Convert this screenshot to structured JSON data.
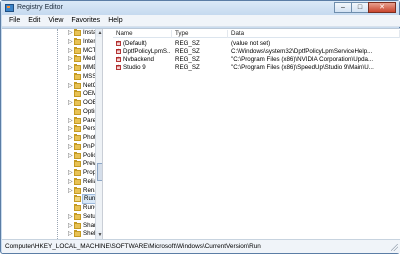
{
  "window": {
    "title": "Registry Editor",
    "controls": [
      "–",
      "□",
      "✕"
    ]
  },
  "menu": [
    "File",
    "Edit",
    "View",
    "Favorites",
    "Help"
  ],
  "tree": {
    "items": [
      {
        "label": "Installe",
        "expander": "▷"
      },
      {
        "label": "Interne",
        "expander": "▷"
      },
      {
        "label": "MCT",
        "expander": "▷"
      },
      {
        "label": "Media",
        "expander": "▷"
      },
      {
        "label": "MMDe",
        "expander": "▷"
      },
      {
        "label": "MSSHA",
        "expander": ""
      },
      {
        "label": "NetCac",
        "expander": "▷"
      },
      {
        "label": "OEMIn",
        "expander": ""
      },
      {
        "label": "OOBE",
        "expander": "▷"
      },
      {
        "label": "Optimi",
        "expander": ""
      },
      {
        "label": "Parenta",
        "expander": "▷"
      },
      {
        "label": "Person",
        "expander": "▷"
      },
      {
        "label": "PhotoP",
        "expander": "▷"
      },
      {
        "label": "PnPSys",
        "expander": "▷"
      },
      {
        "label": "Policies",
        "expander": "▷"
      },
      {
        "label": "Preview",
        "expander": ""
      },
      {
        "label": "Proper",
        "expander": "▷"
      },
      {
        "label": "Reliabi",
        "expander": "▷"
      },
      {
        "label": "Renam",
        "expander": "▷"
      },
      {
        "label": "Run",
        "expander": "",
        "selected": true
      },
      {
        "label": "RunOn",
        "expander": ""
      },
      {
        "label": "Setup",
        "expander": "▷"
      },
      {
        "label": "Shared",
        "expander": "▷"
      },
      {
        "label": "Shell Ex",
        "expander": "▷"
      }
    ]
  },
  "table": {
    "columns": [
      "Name",
      "Type",
      "Data"
    ],
    "rows": [
      {
        "name": "(Default)",
        "type": "REG_SZ",
        "data": "(value not set)"
      },
      {
        "name": "DptfPolicyLpmS...",
        "type": "REG_SZ",
        "data": "C:\\Windows\\system32\\DptfPolicyLpmServiceHelp..."
      },
      {
        "name": "Nvbackend",
        "type": "REG_SZ",
        "data": "\"C:\\Program Files (x86)\\NVIDIA Corporation\\Upda..."
      },
      {
        "name": "Studio 9",
        "type": "REG_SZ",
        "data": "\"C:\\Program Files (x86)\\SpeedUp\\Studio 9\\Main\\U..."
      }
    ]
  },
  "status": {
    "path": "Computer\\HKEY_LOCAL_MACHINE\\SOFTWARE\\Microsoft\\Windows\\CurrentVersion\\Run"
  },
  "colors": {
    "selection": "#d9e8f7",
    "folder": "#e8c255",
    "title_bar": "#c5d9ef"
  }
}
